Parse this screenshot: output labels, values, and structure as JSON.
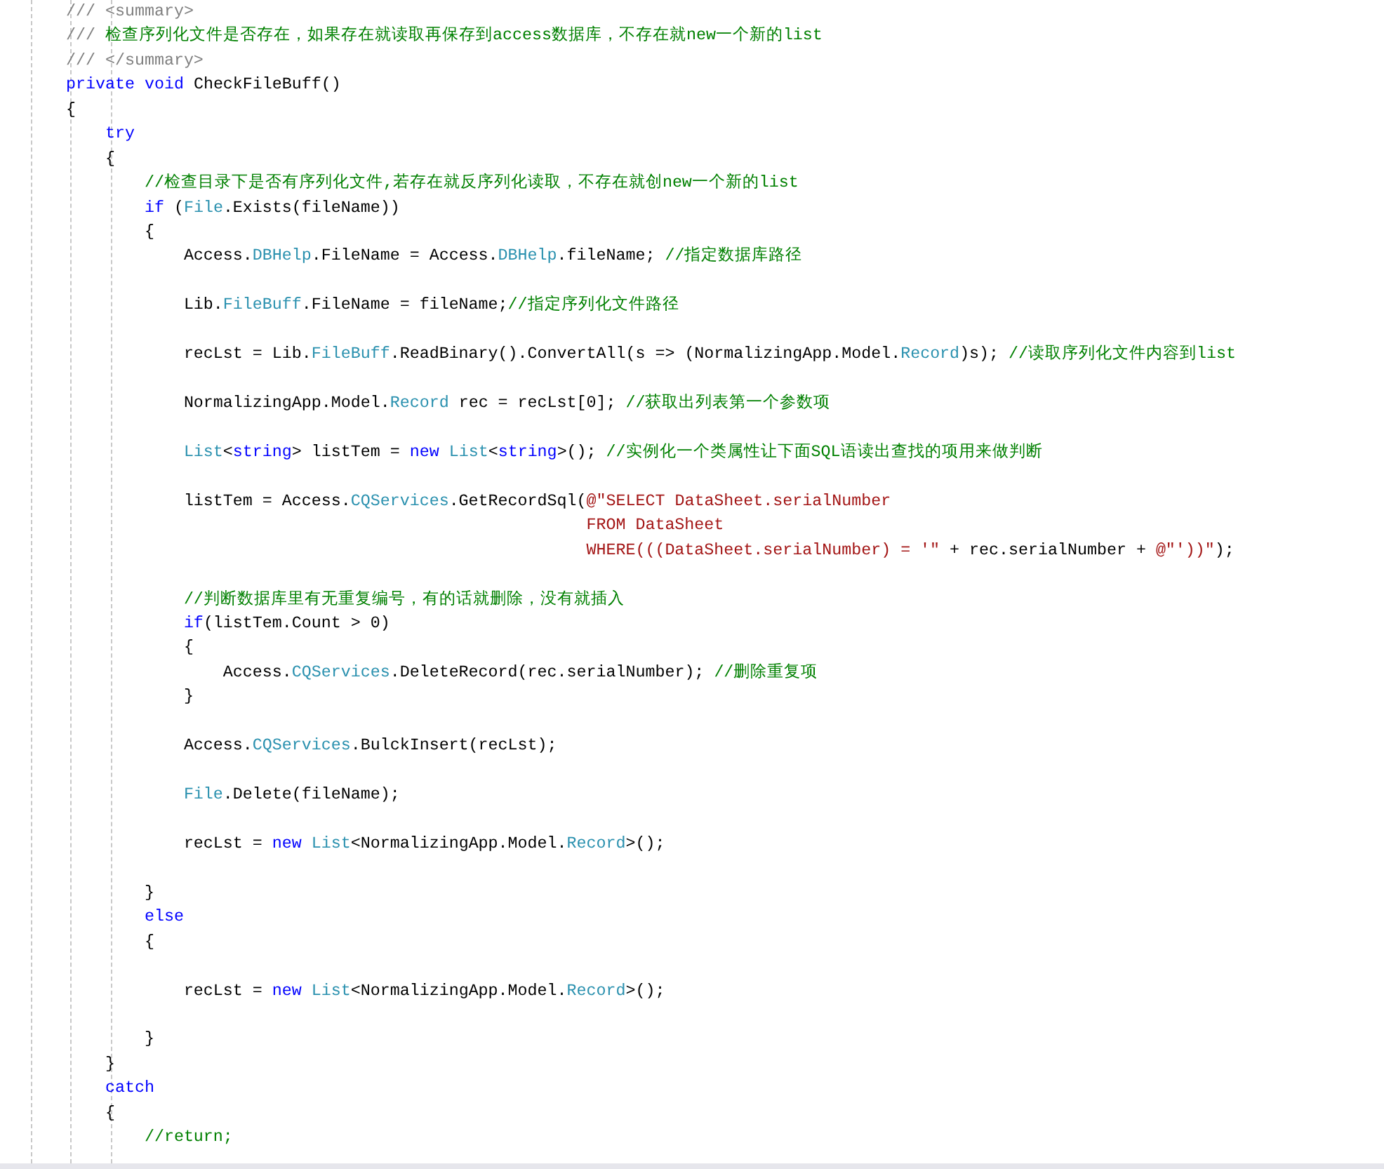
{
  "editor": {
    "lines": [
      {
        "kind": "code",
        "tokens": [
          {
            "kind": "doc",
            "text": "/// <summary>"
          }
        ]
      },
      {
        "kind": "code",
        "tokens": [
          {
            "kind": "doc",
            "text": "/// "
          },
          {
            "kind": "comment",
            "text": "检查序列化文件是否存在，如果存在就读取再保存到access数据库，不存在就new一个新的list"
          }
        ]
      },
      {
        "kind": "code",
        "tokens": [
          {
            "kind": "doc",
            "text": "/// </summary>"
          }
        ]
      },
      {
        "kind": "code",
        "tokens": [
          {
            "kind": "keyword",
            "text": "private void"
          },
          {
            "kind": "plain",
            "text": " CheckFileBuff()"
          }
        ]
      },
      {
        "kind": "code",
        "tokens": [
          {
            "kind": "plain",
            "text": "{"
          }
        ]
      },
      {
        "kind": "code",
        "tokens": [
          {
            "kind": "keyword",
            "text": "    try"
          }
        ]
      },
      {
        "kind": "code",
        "tokens": [
          {
            "kind": "plain",
            "text": "    {"
          }
        ]
      },
      {
        "kind": "code",
        "tokens": [
          {
            "kind": "comment",
            "text": "        //检查目录下是否有序列化文件,若存在就反序列化读取，不存在就创new一个新的list"
          }
        ]
      },
      {
        "kind": "code",
        "tokens": [
          {
            "kind": "keyword",
            "text": "        if"
          },
          {
            "kind": "plain",
            "text": " ("
          },
          {
            "kind": "type",
            "text": "File"
          },
          {
            "kind": "plain",
            "text": ".Exists(fileName))"
          }
        ]
      },
      {
        "kind": "code",
        "tokens": [
          {
            "kind": "plain",
            "text": "        {"
          }
        ]
      },
      {
        "kind": "code",
        "tokens": [
          {
            "kind": "plain",
            "text": "            Access."
          },
          {
            "kind": "type",
            "text": "DBHelp"
          },
          {
            "kind": "plain",
            "text": ".FileName = Access."
          },
          {
            "kind": "type",
            "text": "DBHelp"
          },
          {
            "kind": "plain",
            "text": ".fileName; "
          },
          {
            "kind": "comment",
            "text": "//指定数据库路径"
          }
        ]
      },
      {
        "kind": "blank"
      },
      {
        "kind": "code",
        "tokens": [
          {
            "kind": "plain",
            "text": "            Lib."
          },
          {
            "kind": "type",
            "text": "FileBuff"
          },
          {
            "kind": "plain",
            "text": ".FileName = fileName;"
          },
          {
            "kind": "comment",
            "text": "//指定序列化文件路径"
          }
        ]
      },
      {
        "kind": "blank"
      },
      {
        "kind": "code",
        "tokens": [
          {
            "kind": "plain",
            "text": "            recLst = Lib."
          },
          {
            "kind": "type",
            "text": "FileBuff"
          },
          {
            "kind": "plain",
            "text": ".ReadBinary().ConvertAll(s => (NormalizingApp.Model."
          },
          {
            "kind": "type",
            "text": "Record"
          },
          {
            "kind": "plain",
            "text": ")s); "
          },
          {
            "kind": "comment",
            "text": "//读取序列化文件内容到list"
          }
        ]
      },
      {
        "kind": "blank"
      },
      {
        "kind": "code",
        "tokens": [
          {
            "kind": "plain",
            "text": "            NormalizingApp.Model."
          },
          {
            "kind": "type",
            "text": "Record"
          },
          {
            "kind": "plain",
            "text": " rec = recLst[0]; "
          },
          {
            "kind": "comment",
            "text": "//获取出列表第一个参数项"
          }
        ]
      },
      {
        "kind": "blank"
      },
      {
        "kind": "code",
        "tokens": [
          {
            "kind": "type",
            "text": "            List"
          },
          {
            "kind": "plain",
            "text": "<"
          },
          {
            "kind": "keyword",
            "text": "string"
          },
          {
            "kind": "plain",
            "text": "> listTem = "
          },
          {
            "kind": "keyword",
            "text": "new "
          },
          {
            "kind": "type",
            "text": "List"
          },
          {
            "kind": "plain",
            "text": "<"
          },
          {
            "kind": "keyword",
            "text": "string"
          },
          {
            "kind": "plain",
            "text": ">(); "
          },
          {
            "kind": "comment",
            "text": "//实例化一个类属性让下面SQL语读出查找的项用来做判断"
          }
        ]
      },
      {
        "kind": "blank"
      },
      {
        "kind": "code",
        "tokens": [
          {
            "kind": "plain",
            "text": "            listTem = Access."
          },
          {
            "kind": "type",
            "text": "CQServices"
          },
          {
            "kind": "plain",
            "text": ".GetRecordSql("
          },
          {
            "kind": "string",
            "text": "@\"SELECT DataSheet.serialNumber"
          }
        ]
      },
      {
        "kind": "code",
        "tokens": [
          {
            "kind": "string",
            "text": "                                                     FROM DataSheet"
          }
        ]
      },
      {
        "kind": "code",
        "tokens": [
          {
            "kind": "string",
            "text": "                                                     WHERE(((DataSheet.serialNumber) = '\""
          },
          {
            "kind": "plain",
            "text": " + rec.serialNumber + "
          },
          {
            "kind": "string",
            "text": "@\"'))\""
          },
          {
            "kind": "plain",
            "text": ");"
          }
        ]
      },
      {
        "kind": "blank"
      },
      {
        "kind": "code",
        "tokens": [
          {
            "kind": "comment",
            "text": "            //判断数据库里有无重复编号，有的话就删除，没有就插入"
          }
        ]
      },
      {
        "kind": "code",
        "tokens": [
          {
            "kind": "keyword",
            "text": "            if"
          },
          {
            "kind": "plain",
            "text": "(listTem.Count > 0)"
          }
        ]
      },
      {
        "kind": "code",
        "tokens": [
          {
            "kind": "plain",
            "text": "            {"
          }
        ]
      },
      {
        "kind": "code",
        "tokens": [
          {
            "kind": "plain",
            "text": "                Access."
          },
          {
            "kind": "type",
            "text": "CQServices"
          },
          {
            "kind": "plain",
            "text": ".DeleteRecord(rec.serialNumber); "
          },
          {
            "kind": "comment",
            "text": "//删除重复项"
          }
        ]
      },
      {
        "kind": "code",
        "tokens": [
          {
            "kind": "plain",
            "text": "            }"
          }
        ]
      },
      {
        "kind": "blank"
      },
      {
        "kind": "code",
        "tokens": [
          {
            "kind": "plain",
            "text": "            Access."
          },
          {
            "kind": "type",
            "text": "CQServices"
          },
          {
            "kind": "plain",
            "text": ".BulckInsert(recLst);"
          }
        ]
      },
      {
        "kind": "blank"
      },
      {
        "kind": "code",
        "tokens": [
          {
            "kind": "type",
            "text": "            File"
          },
          {
            "kind": "plain",
            "text": ".Delete(fileName);"
          }
        ]
      },
      {
        "kind": "blank"
      },
      {
        "kind": "code",
        "tokens": [
          {
            "kind": "plain",
            "text": "            recLst = "
          },
          {
            "kind": "keyword",
            "text": "new "
          },
          {
            "kind": "type",
            "text": "List"
          },
          {
            "kind": "plain",
            "text": "<NormalizingApp.Model."
          },
          {
            "kind": "type",
            "text": "Record"
          },
          {
            "kind": "plain",
            "text": ">();"
          }
        ]
      },
      {
        "kind": "blank"
      },
      {
        "kind": "code",
        "tokens": [
          {
            "kind": "plain",
            "text": "        }"
          }
        ]
      },
      {
        "kind": "code",
        "tokens": [
          {
            "kind": "keyword",
            "text": "        else"
          }
        ]
      },
      {
        "kind": "code",
        "tokens": [
          {
            "kind": "plain",
            "text": "        {"
          }
        ]
      },
      {
        "kind": "blank"
      },
      {
        "kind": "code",
        "tokens": [
          {
            "kind": "plain",
            "text": "            recLst = "
          },
          {
            "kind": "keyword",
            "text": "new "
          },
          {
            "kind": "type",
            "text": "List"
          },
          {
            "kind": "plain",
            "text": "<NormalizingApp.Model."
          },
          {
            "kind": "type",
            "text": "Record"
          },
          {
            "kind": "plain",
            "text": ">();"
          }
        ]
      },
      {
        "kind": "blank"
      },
      {
        "kind": "code",
        "tokens": [
          {
            "kind": "plain",
            "text": "        }"
          }
        ]
      },
      {
        "kind": "code",
        "tokens": [
          {
            "kind": "plain",
            "text": "    }"
          }
        ]
      },
      {
        "kind": "code",
        "tokens": [
          {
            "kind": "keyword",
            "text": "    catch"
          }
        ]
      },
      {
        "kind": "code",
        "tokens": [
          {
            "kind": "plain",
            "text": "    {"
          }
        ]
      },
      {
        "kind": "code",
        "tokens": [
          {
            "kind": "comment",
            "text": "        //return;"
          }
        ]
      }
    ]
  }
}
